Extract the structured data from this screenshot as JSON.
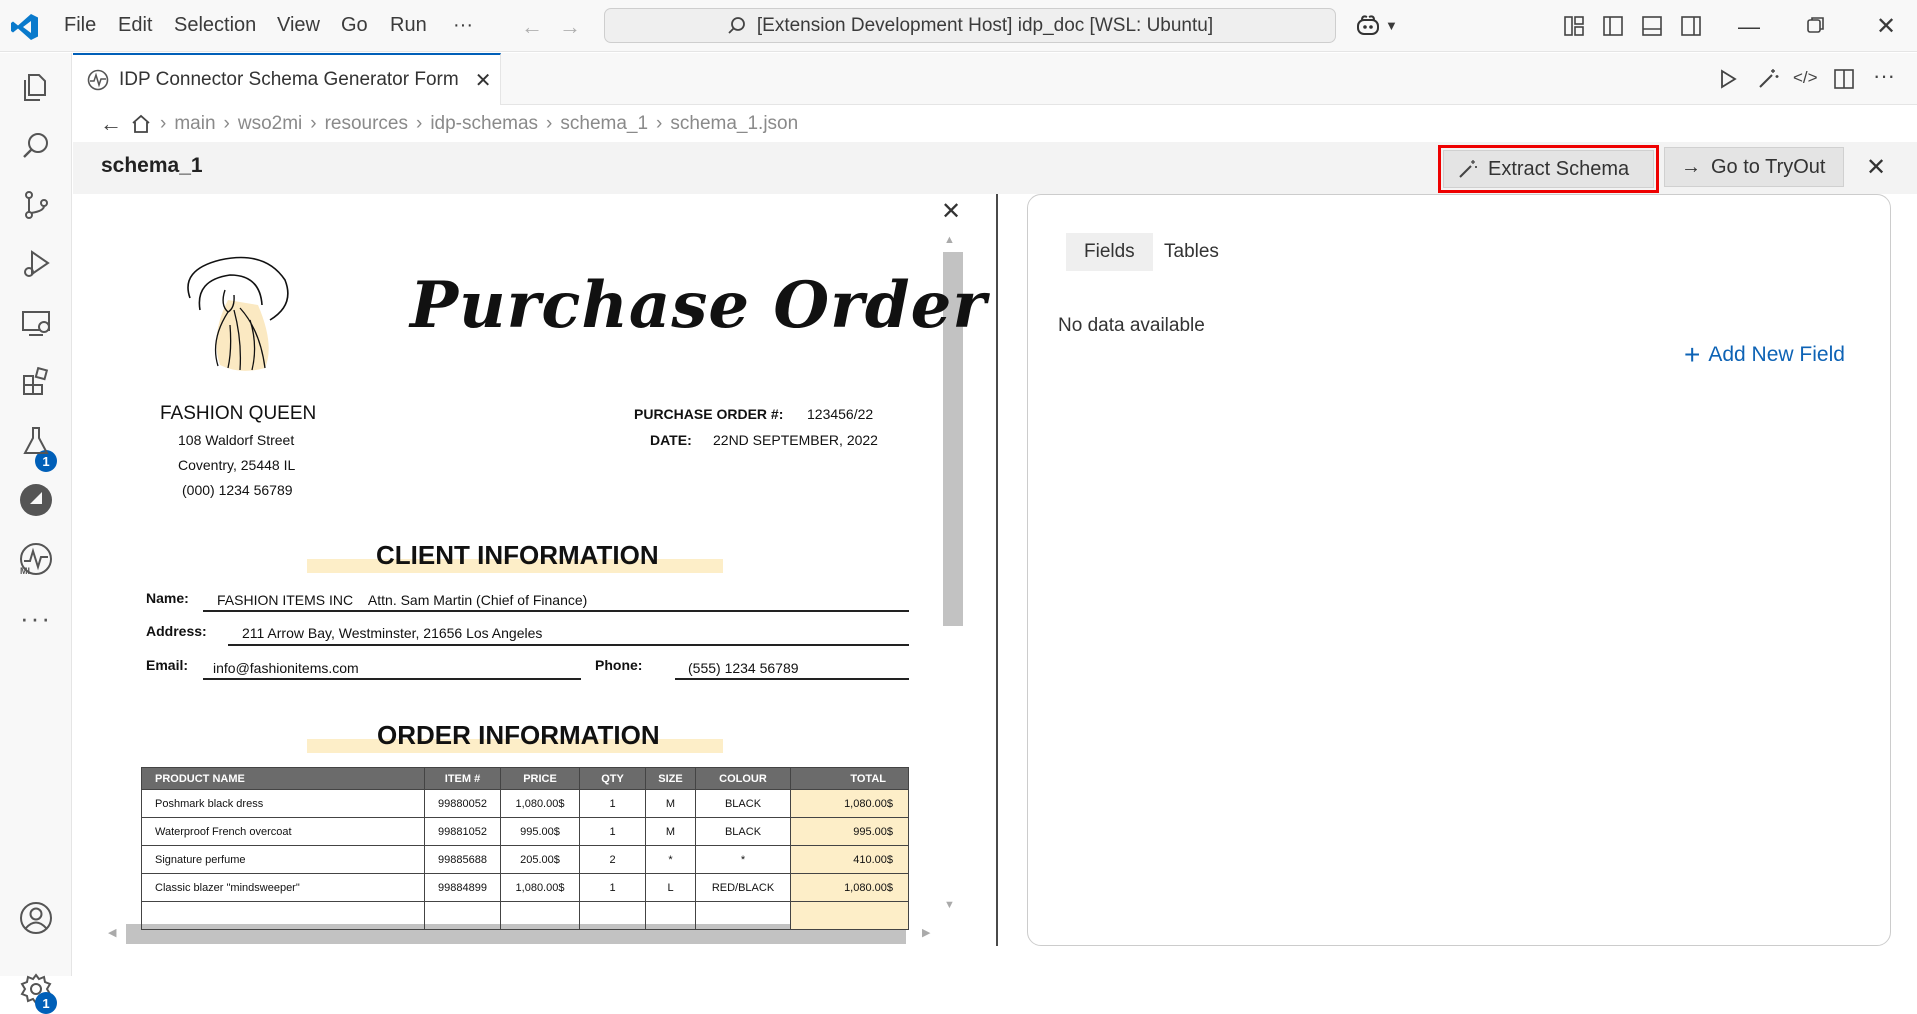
{
  "titlebar": {
    "menu": [
      "File",
      "Edit",
      "Selection",
      "View",
      "Go",
      "Run",
      "···"
    ],
    "command_center": "[Extension Development Host] idp_doc [WSL: Ubuntu]"
  },
  "activity": {
    "extensions_badge": "1",
    "settings_badge": "1"
  },
  "tab": {
    "label": "IDP Connector Schema Generator Form"
  },
  "breadcrumb": [
    "main",
    "wso2mi",
    "resources",
    "idp-schemas",
    "schema_1",
    "schema_1.json"
  ],
  "header": {
    "title": "schema_1",
    "extract_label": "Extract Schema",
    "tryout_label": "Go to TryOut"
  },
  "document": {
    "title": "Purchase Order",
    "company": {
      "name": "FASHION QUEEN",
      "street": "108 Waldorf Street",
      "city": "Coventry, 25448 IL",
      "phone": "(000) 1234 56789"
    },
    "po_number_label": "PURCHASE ORDER #:",
    "po_number": "123456/22",
    "date_label": "DATE:",
    "date": "22ND SEPTEMBER, 2022",
    "client_heading": "CLIENT INFORMATION",
    "client": {
      "name_label": "Name:",
      "name": "FASHION ITEMS INC    Attn. Sam Martin (Chief of Finance)",
      "address_label": "Address:",
      "address": "211 Arrow Bay, Westminster, 21656 Los Angeles",
      "email_label": "Email:",
      "email": "info@fashionitems.com",
      "phone_label": "Phone:",
      "phone": "(555) 1234 56789"
    },
    "order_heading": "ORDER INFORMATION",
    "columns": [
      "PRODUCT NAME",
      "ITEM #",
      "PRICE",
      "QTY",
      "SIZE",
      "COLOUR",
      "TOTAL"
    ],
    "rows": [
      [
        "Poshmark black dress",
        "99880052",
        "1,080.00$",
        "1",
        "M",
        "BLACK",
        "1,080.00$"
      ],
      [
        "Waterproof French overcoat",
        "99881052",
        "995.00$",
        "1",
        "M",
        "BLACK",
        "995.00$"
      ],
      [
        "Signature perfume",
        "99885688",
        "205.00$",
        "2",
        "*",
        "*",
        "410.00$"
      ],
      [
        "Classic blazer \"mindsweeper\"",
        "99884899",
        "1,080.00$",
        "1",
        "L",
        "RED/BLACK",
        "1,080.00$"
      ],
      [
        "",
        "",
        "",
        "",
        "",
        "",
        ""
      ]
    ]
  },
  "panel": {
    "tabs": [
      "Fields",
      "Tables"
    ],
    "empty_text": "No data available",
    "add_label": "Add New Field"
  }
}
